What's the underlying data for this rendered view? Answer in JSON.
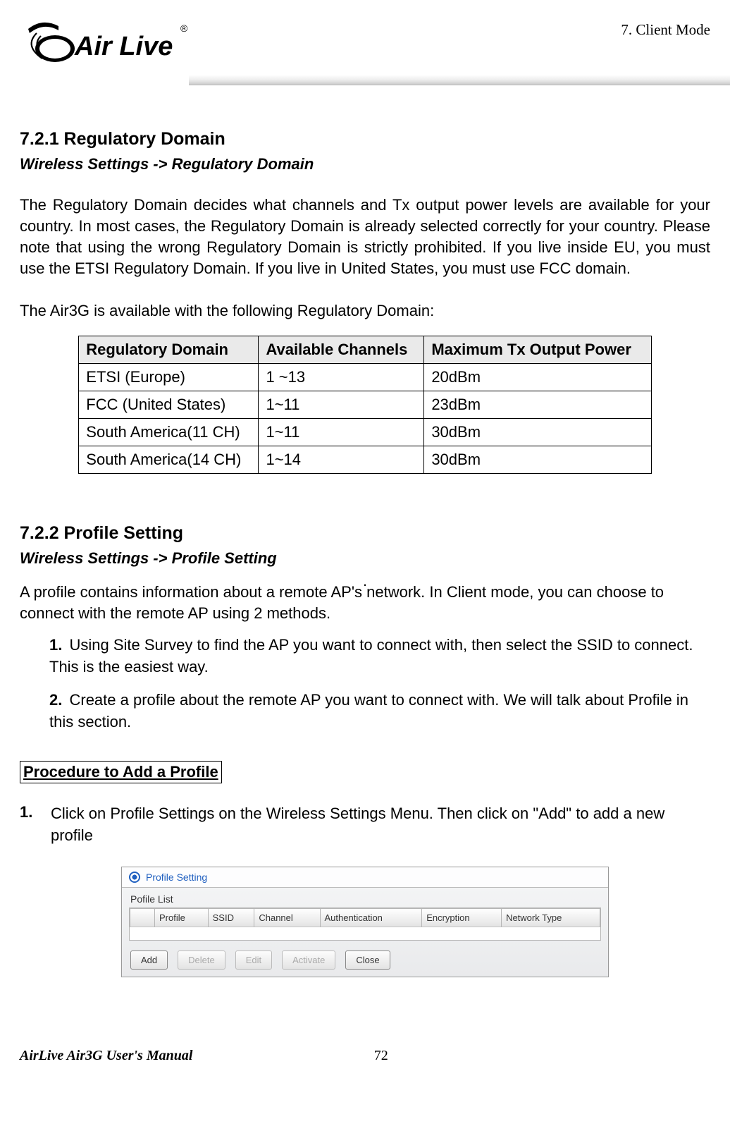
{
  "header": {
    "right": "7.    Client  Mode"
  },
  "logo": {
    "brand_top": "Air Live",
    "reg": "®"
  },
  "section1": {
    "heading": "7.2.1 Regulatory Domain",
    "breadcrumb": "Wireless Settings -> Regulatory Domain",
    "para1": "The Regulatory Domain decides what channels and Tx output power levels are available for your country.    In most cases, the Regulatory Domain is already selected correctly for your country.    Please note that using the wrong Regulatory Domain is strictly prohibited. If you live inside EU, you must use the ETSI Regulatory Domain.    If you live in United States, you must use FCC domain.",
    "para2": "The Air3G is available with the following Regulatory Domain:",
    "table": {
      "headers": [
        "Regulatory Domain",
        "Available Channels",
        "Maximum Tx Output Power"
      ],
      "rows": [
        [
          "ETSI (Europe)",
          "1 ~13",
          "20dBm"
        ],
        [
          "FCC (United States)",
          "1~11",
          "23dBm"
        ],
        [
          "South America(11 CH)",
          "1~11",
          "30dBm"
        ],
        [
          "South America(14 CH)",
          "1~14",
          "30dBm"
        ]
      ]
    }
  },
  "section2": {
    "heading": "7.2.2 Profile Setting",
    "breadcrumb": "Wireless Settings -> Profile Setting",
    "dot": ".",
    "intro": "A profile contains information about a remote AP's network.    In Client mode, you can choose to connect with the remote AP using 2 methods.",
    "items": [
      {
        "num": "1.",
        "text": "Using Site Survey to find the AP you want to connect with, then select the SSID to connect.    This is the easiest way."
      },
      {
        "num": "2.",
        "text": "Create a profile about the remote AP you want to connect with.    We will talk about Profile in this section."
      }
    ],
    "proc_header": "Procedure to Add a Profile",
    "step1": {
      "num": "1.",
      "text": "Click on Profile Settings on the Wireless Settings Menu.    Then click on \"Add\" to add a new profile"
    }
  },
  "screenshot": {
    "title": "Profile Setting",
    "list_label": "Pofile List",
    "cols": [
      "",
      "Profile",
      "SSID",
      "Channel",
      "Authentication",
      "Encryption",
      "Network Type"
    ],
    "buttons": [
      {
        "label": "Add",
        "disabled": false
      },
      {
        "label": "Delete",
        "disabled": true
      },
      {
        "label": "Edit",
        "disabled": true
      },
      {
        "label": "Activate",
        "disabled": true
      },
      {
        "label": "Close",
        "disabled": false
      }
    ]
  },
  "footer": {
    "left": "AirLive Air3G User's Manual",
    "page": "72"
  }
}
